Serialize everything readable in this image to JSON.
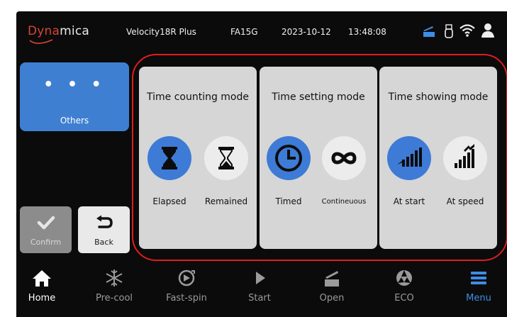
{
  "status_bar": {
    "logo_part1": "Dyna",
    "logo_part2": "mica",
    "model": "Velocity18R Plus",
    "rotor": "FA15G",
    "date": "2023-10-12",
    "time": "13:48:08",
    "icons": [
      "open-lid-icon",
      "usb-icon",
      "wifi-icon",
      "user-icon"
    ]
  },
  "left_panel": {
    "others_dots": "• • •",
    "others_label": "Others",
    "confirm_label": "Confirm",
    "back_label": "Back"
  },
  "panels": [
    {
      "title": "Time counting mode",
      "options": [
        {
          "label": "Elapsed",
          "icon": "hourglass-top-icon",
          "selected": true
        },
        {
          "label": "Remained",
          "icon": "hourglass-bottom-icon",
          "selected": false
        }
      ]
    },
    {
      "title": "Time setting mode",
      "options": [
        {
          "label": "Timed",
          "icon": "clock-icon",
          "selected": true
        },
        {
          "label": "Contineuous",
          "icon": "infinity-icon",
          "selected": false
        }
      ]
    },
    {
      "title": "Time showing mode",
      "options": [
        {
          "label": "At start",
          "icon": "signal-bars-icon",
          "selected": true
        },
        {
          "label": "At speed",
          "icon": "signal-bars-flag-icon",
          "selected": false
        }
      ]
    }
  ],
  "nav": [
    {
      "label": "Home",
      "icon": "home-icon",
      "state": "normal"
    },
    {
      "label": "Pre-cool",
      "icon": "snowflake-icon",
      "state": "dim"
    },
    {
      "label": "Fast-spin",
      "icon": "fast-spin-icon",
      "state": "dim"
    },
    {
      "label": "Start",
      "icon": "play-icon",
      "state": "dim"
    },
    {
      "label": "Open",
      "icon": "open-lid-icon",
      "state": "dim"
    },
    {
      "label": "ECO",
      "icon": "eco-icon",
      "state": "dim"
    },
    {
      "label": "Menu",
      "icon": "menu-icon",
      "state": "active"
    }
  ],
  "colors": {
    "accent": "#3f7fd2",
    "highlight": "#e01d1d",
    "panel_bg": "#d6d6d6",
    "screen_bg": "#0b0b0b",
    "logo_red": "#d94437"
  }
}
